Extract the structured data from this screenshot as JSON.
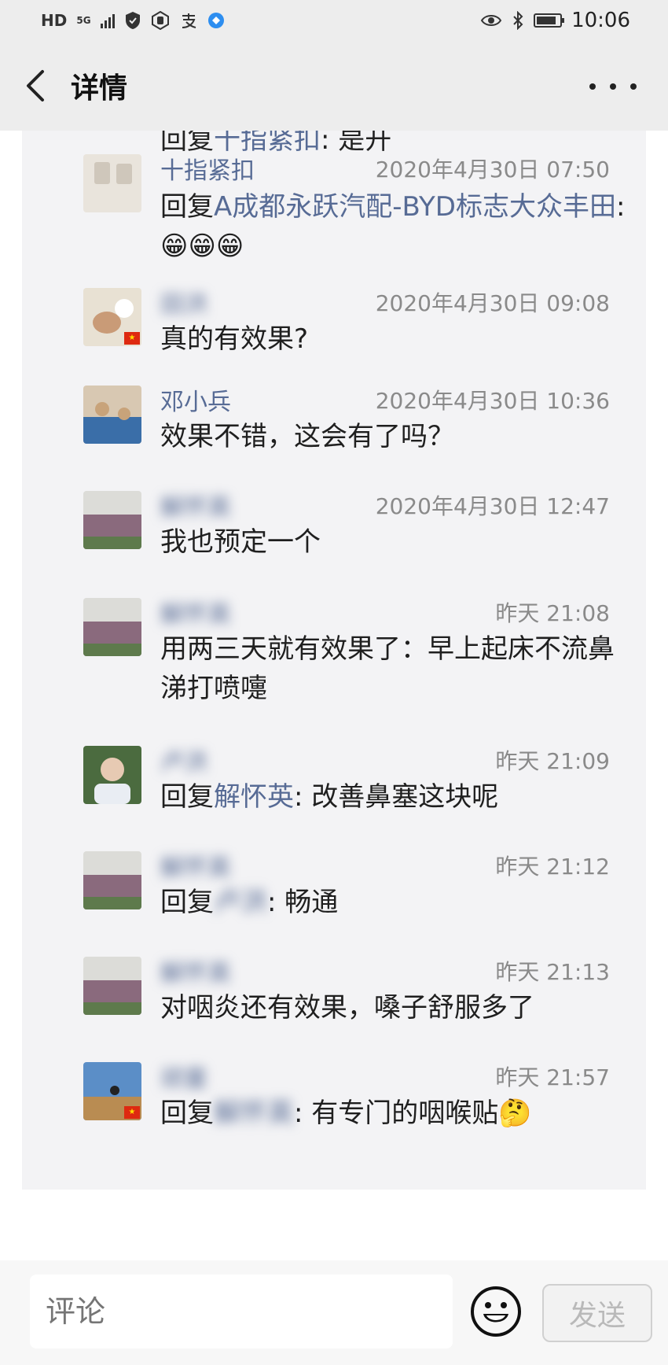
{
  "status_bar": {
    "left_icons": [
      "HD",
      "5G",
      "signal-icon",
      "shield-icon",
      "hand-icon",
      "alipay-icon",
      "browser-icon"
    ],
    "right_icons": [
      "eye-icon",
      "bluetooth-icon",
      "battery-icon"
    ],
    "battery_level": 0.85,
    "time": "10:06"
  },
  "header": {
    "back_icon": "chevron-left-icon",
    "title": "详情",
    "more_icon": "more-dots-icon"
  },
  "cut_off_row": {
    "prefix": "回复",
    "name": "十指紧扣",
    "suffix": ": 是开"
  },
  "comments": [
    {
      "name": "十指紧扣",
      "time": "2020年4月30日 07:50",
      "reply_prefix": "回复",
      "reply_to": "A成都永跃汽配-BYD标志大众丰田",
      "text": ": 😁😁😁",
      "avatar_colors": [
        "#e9e4dc",
        "#cfc7bb"
      ]
    },
    {
      "name": "田洪",
      "time": "2020年4月30日 09:08",
      "text": "真的有效果?",
      "avatar_colors": [
        "#e8e1d3",
        "#c99b77"
      ]
    },
    {
      "name": "邓小兵",
      "time": "2020年4月30日 10:36",
      "text": "效果不错，这会有了吗？",
      "avatar_colors": [
        "#3a6ea8",
        "#c8a37a"
      ]
    },
    {
      "name": "解怀英",
      "time": "2020年4月30日 12:47",
      "text": "我也预定一个",
      "avatar_colors": [
        "#8a6a7d",
        "#5e7a4c"
      ]
    },
    {
      "name": "解怀英",
      "time": "昨天 21:08",
      "text": "用两三天就有效果了：早上起床不流鼻涕打喷嚏",
      "avatar_colors": [
        "#8a6a7d",
        "#5e7a4c"
      ]
    },
    {
      "name": "卢洪",
      "time": "昨天 21:09",
      "reply_prefix": "回复",
      "reply_to": "解怀英",
      "text": ": 改善鼻塞这块呢",
      "avatar_colors": [
        "#4b6b3f",
        "#e7cab3"
      ]
    },
    {
      "name": "解怀英",
      "time": "昨天 21:12",
      "reply_prefix": "回复",
      "reply_to": "卢洪",
      "text": ": 畅通",
      "avatar_colors": [
        "#8a6a7d",
        "#5e7a4c"
      ]
    },
    {
      "name": "解怀英",
      "time": "昨天 21:13",
      "text": "对咽炎还有效果，嗓子舒服多了",
      "avatar_colors": [
        "#8a6a7d",
        "#5e7a4c"
      ]
    },
    {
      "name": "顽童",
      "time": "昨天 21:57",
      "reply_prefix": "回复",
      "reply_to": "解怀英",
      "text": ": 有专门的咽喉贴🤔",
      "avatar_colors": [
        "#5b8ec7",
        "#b98c52"
      ]
    }
  ],
  "composer": {
    "placeholder": "评论",
    "emoji_icon": "smiley-icon",
    "send_label": "发送"
  }
}
